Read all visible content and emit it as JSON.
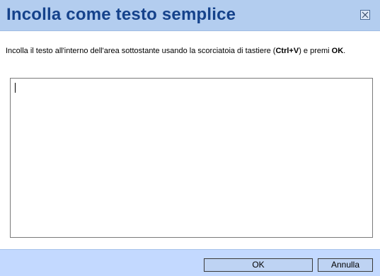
{
  "dialog": {
    "title": "Incolla come testo semplice",
    "close_icon": "close-icon",
    "instructions": {
      "part1": "Incolla il testo all'interno dell'area sottostante usando la scorciatoia di tastiere (",
      "shortcut": "Ctrl+V",
      "part2": ") e premi ",
      "ok_word": "OK",
      "part3": "."
    },
    "textarea": {
      "value": "",
      "placeholder": ""
    },
    "buttons": {
      "ok_label": "OK",
      "cancel_label": "Annulla"
    }
  },
  "colors": {
    "titlebar_bg": "#b3cdef",
    "title_text": "#15428b",
    "footer_bg": "#c3d9ff",
    "button_bg": "#bed3f3"
  }
}
